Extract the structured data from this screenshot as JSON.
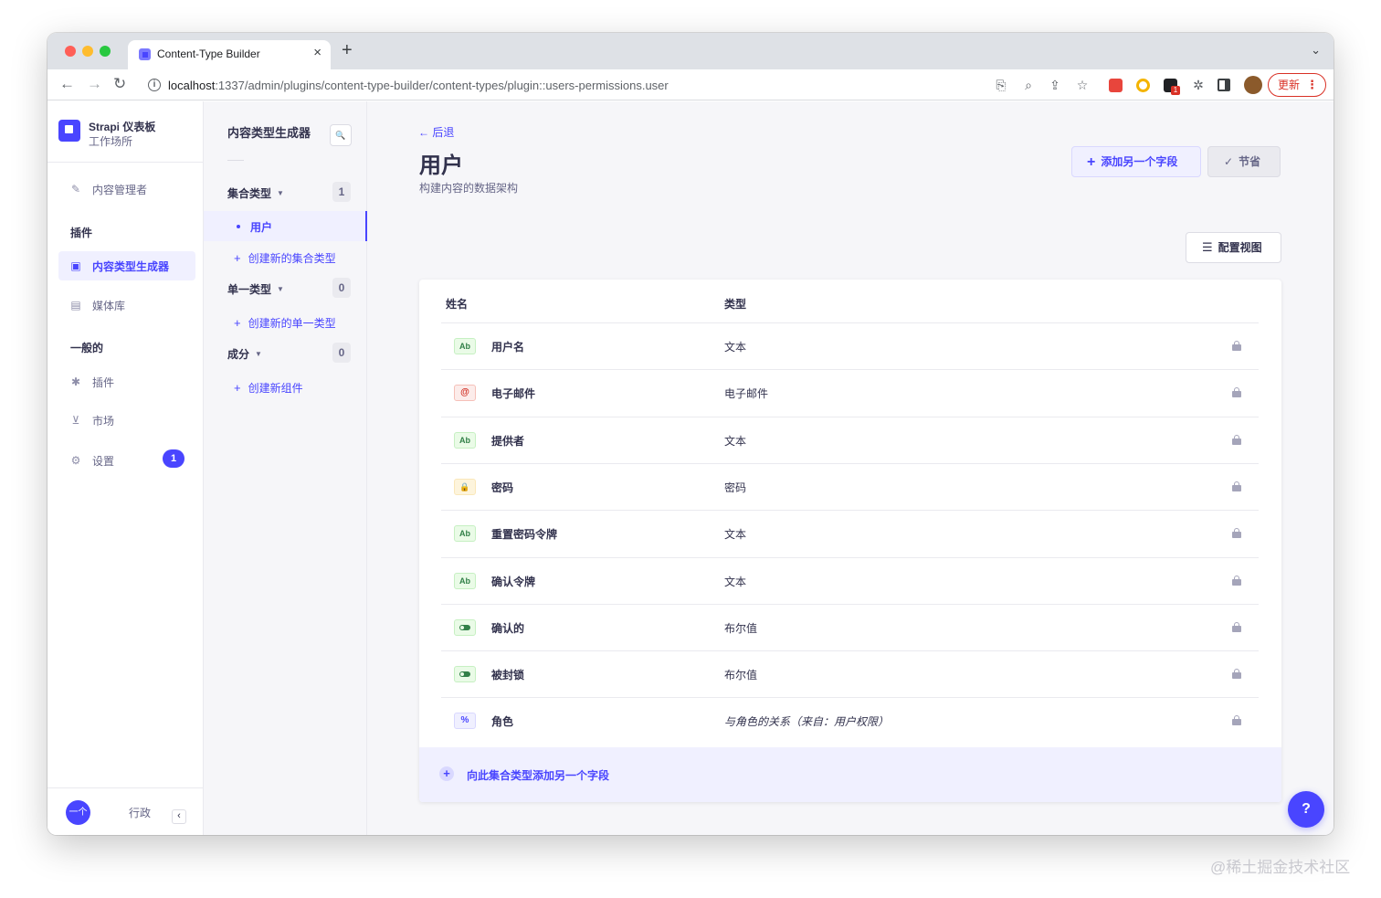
{
  "browser": {
    "tab_title": "Content-Type Builder",
    "tab_close": "×",
    "new_tab": "+",
    "tabs_menu": "⌄",
    "url_host": "localhost",
    "url_path": ":1337/admin/plugins/content-type-builder/content-types/plugin::users-permissions.user",
    "update_label": "更新",
    "update_menu": "⋮",
    "extension_badge": "1"
  },
  "brand": {
    "title": "Strapi 仪表板",
    "subtitle": "工作场所"
  },
  "leftnav": {
    "content_manager": "内容管理者",
    "section_plugins": "插件",
    "content_type_builder": "内容类型生成器",
    "media_library": "媒体库",
    "section_general": "一般的",
    "plugins": "插件",
    "marketplace": "市场",
    "settings": "设置",
    "settings_badge": "1",
    "avatar_text": "一个",
    "footer_label": "行政",
    "collapse": "‹"
  },
  "subnav": {
    "title": "内容类型生成器",
    "collection_types": "集合类型",
    "collection_count": "1",
    "active_item": "用户",
    "create_collection": "创建新的集合类型",
    "single_types": "单一类型",
    "single_count": "0",
    "components": "成分",
    "components_count": "0",
    "create_single": "创建新的单一类型",
    "create_component": "创建新组件"
  },
  "main": {
    "back": "后退",
    "title": "用户",
    "subtitle": "构建内容的数据架构",
    "add_field": "添加另一个字段",
    "save": "节省",
    "configure_view": "配置视图",
    "col_name": "姓名",
    "col_type": "类型",
    "add_to_collection": "向此集合类型添加另一个字段",
    "help": "?"
  },
  "fields": [
    {
      "icon": "Ab",
      "kind": "text",
      "name": "用户名",
      "type": "文本"
    },
    {
      "icon": "@",
      "kind": "email",
      "name": "电子邮件",
      "type": "电子邮件"
    },
    {
      "icon": "Ab",
      "kind": "text",
      "name": "提供者",
      "type": "文本"
    },
    {
      "icon": "🔒",
      "kind": "password",
      "name": "密码",
      "type": "密码"
    },
    {
      "icon": "Ab",
      "kind": "text",
      "name": "重置密码令牌",
      "type": "文本"
    },
    {
      "icon": "Ab",
      "kind": "text",
      "name": "确认令牌",
      "type": "文本"
    },
    {
      "icon": "",
      "kind": "bool",
      "name": "确认的",
      "type": "布尔值"
    },
    {
      "icon": "",
      "kind": "bool",
      "name": "被封锁",
      "type": "布尔值"
    },
    {
      "icon": "%",
      "kind": "rel",
      "name": "角色",
      "type": "与角色的关系（来自：用户权限）"
    }
  ],
  "watermark": "@稀土掘金技术社区",
  "colors": {
    "primary": "#4945ff",
    "primary_light": "#f0f0ff",
    "text": "#32324d",
    "muted": "#666687"
  }
}
